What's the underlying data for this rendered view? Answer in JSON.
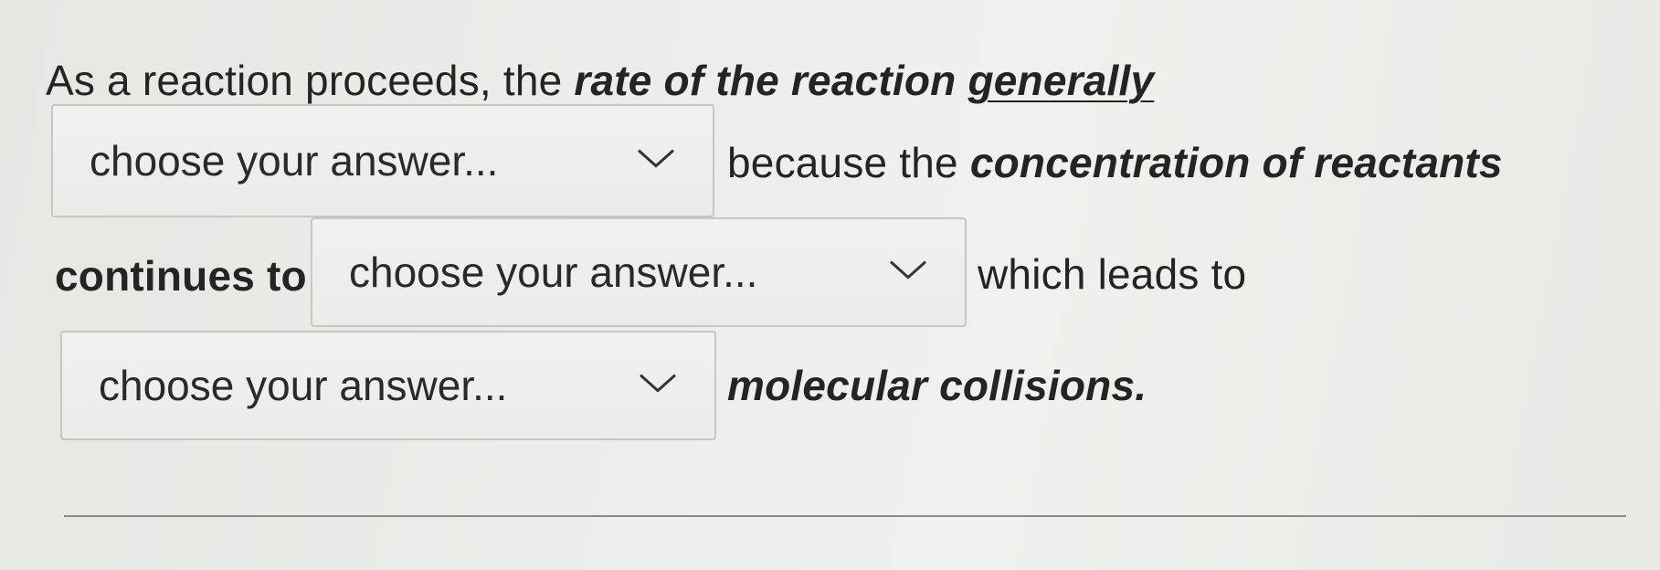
{
  "question": {
    "line1_plain": "As a reaction proceeds, the ",
    "line1_bold_italic": "rate of the reaction ",
    "line1_underlined": "generally",
    "after_select1": "because the ",
    "after_select1_bold_italic": "concentration of reactants",
    "before_select2_bold": "continues to",
    "after_select2": "which leads to",
    "after_select3_bold_italic": "molecular collisions."
  },
  "selects": [
    {
      "selected": "choose your answer...",
      "icon": "chevron-down-icon"
    },
    {
      "selected": "choose your answer...",
      "icon": "chevron-down-icon"
    },
    {
      "selected": "choose your answer...",
      "icon": "chevron-down-icon"
    }
  ]
}
